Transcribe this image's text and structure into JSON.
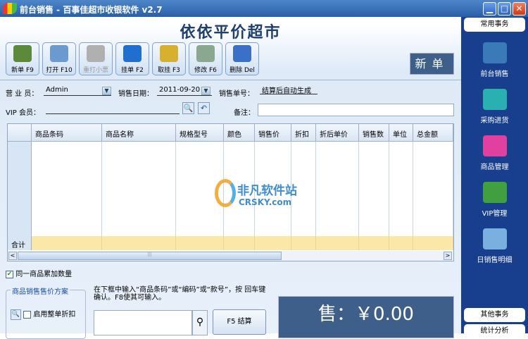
{
  "window": {
    "title": "前台销售 - 百事佳超市收银软件 v2.7",
    "min": "▁",
    "max": "□",
    "close": "✕"
  },
  "shop_name": "依依平价超市",
  "toolbar": [
    {
      "label": "新单 F9",
      "color": "#5a8a3a",
      "enabled": true
    },
    {
      "label": "打开 F10",
      "color": "#6a9ad0",
      "enabled": true
    },
    {
      "label": "重打小票",
      "color": "#b0b0b0",
      "enabled": false
    },
    {
      "label": "挂单 F2",
      "color": "#1e6fd0",
      "enabled": true
    },
    {
      "label": "取挂 F3",
      "color": "#d8b030",
      "enabled": true
    },
    {
      "label": "修改 F6",
      "color": "#8aa890",
      "enabled": true
    },
    {
      "label": "删除 Del",
      "color": "#3a70c8",
      "enabled": true
    }
  ],
  "mode_label": "新单",
  "form": {
    "clerk_label": "营 业 员：",
    "clerk_value": "Admin",
    "date_label": "销售日期：",
    "date_value": "2011-09-20",
    "order_label": "销售单号：",
    "order_value": "结算后自动生成",
    "vip_label": "VIP 会员：",
    "vip_value": "",
    "note_label": "备注：",
    "note_value": ""
  },
  "grid": {
    "columns": [
      "商品条码",
      "商品名称",
      "规格型号",
      "颜色",
      "销售价",
      "折扣",
      "折后单价",
      "销售数",
      "单位",
      "总金额"
    ],
    "total_label": "合计",
    "scroll_left": "<",
    "scroll_right": ">",
    "scroll_grip": "|||"
  },
  "accumulate": {
    "label": "同一商品累加数量",
    "checked": true,
    "mark": "✔"
  },
  "price_scheme": {
    "title": "商品销售售价方案",
    "option1": "启用整单折扣",
    "checked": false
  },
  "hint": "在下框中输入“商品条码”或“编码”或“款号”，按 回车键 确认。F8使其可输入。",
  "barcode_input": "",
  "settle_button": "F5 结算",
  "sale_total": "售：￥0.00",
  "sidebar": {
    "tab_common": "常用事务",
    "items": [
      {
        "label": "前台销售",
        "color": "#3a7ab8"
      },
      {
        "label": "采购进货",
        "color": "#2ab0b0"
      },
      {
        "label": "商品管理",
        "color": "#e040a0"
      },
      {
        "label": "VIP管理",
        "color": "#40a040"
      },
      {
        "label": "日销售明细",
        "color": "#7ab0e0"
      }
    ],
    "tab_other": "其他事务",
    "tab_stats": "统计分析"
  },
  "watermark": {
    "line1": "非凡软件站",
    "line2": "CRSKY.com"
  }
}
